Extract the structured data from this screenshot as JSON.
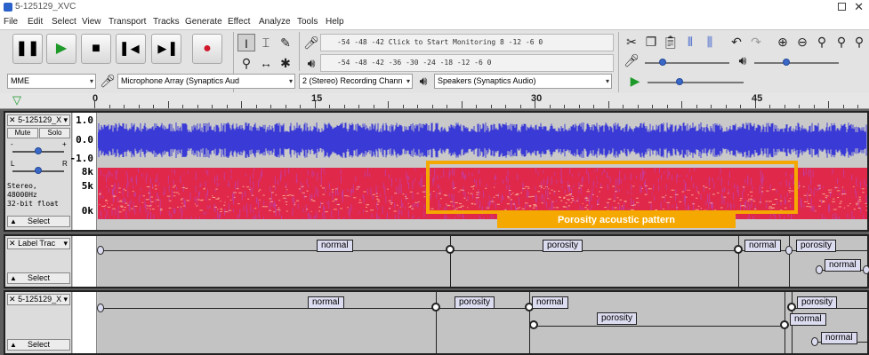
{
  "window": {
    "title": "5-125129_XVC"
  },
  "menu": [
    "File",
    "Edit",
    "Select",
    "View",
    "Transport",
    "Tracks",
    "Generate",
    "Effect",
    "Analyze",
    "Tools",
    "Help"
  ],
  "meters": {
    "record_labels": "-54   -48   -42  Click to Start Monitoring  8   -12    -6    0",
    "playback_labels": "-54   -48   -42   -36   -30   -24   -18   -12    -6    0"
  },
  "devices": {
    "host": "MME",
    "recording_device": "Microphone Array (Synaptics Aud",
    "channels": "2 (Stereo) Recording Chann",
    "playback_device": "Speakers (Synaptics Audio)"
  },
  "ruler": {
    "labels": [
      "0",
      "15",
      "30",
      "45"
    ]
  },
  "track1": {
    "name": "5-125129_X",
    "mute": "Mute",
    "solo": "Solo",
    "pan_left": "L",
    "pan_right": "R",
    "gain_minus": "-",
    "gain_plus": "+",
    "info_line1": "Stereo, 48000Hz",
    "info_line2": "32-bit float",
    "select": "Select",
    "wave_scale": [
      "1.0",
      "0.0",
      "-1.0"
    ],
    "spec_scale": [
      "8k",
      "5k",
      "0k"
    ],
    "annotation": "Porosity acoustic pattern",
    "colors": {
      "waveform": "#3a3ad6",
      "spectrogram": "#e0284a",
      "highlight": "#f5a800"
    }
  },
  "track2": {
    "name": "Label Trac",
    "select": "Select",
    "labels": [
      "normal",
      "porosity",
      "normal",
      "porosity",
      "normal"
    ]
  },
  "track3": {
    "name": "5-125129_X",
    "select": "Select",
    "labels": [
      "normal",
      "porosity",
      "normal",
      "porosity",
      "porosity",
      "normal",
      "normal"
    ]
  }
}
